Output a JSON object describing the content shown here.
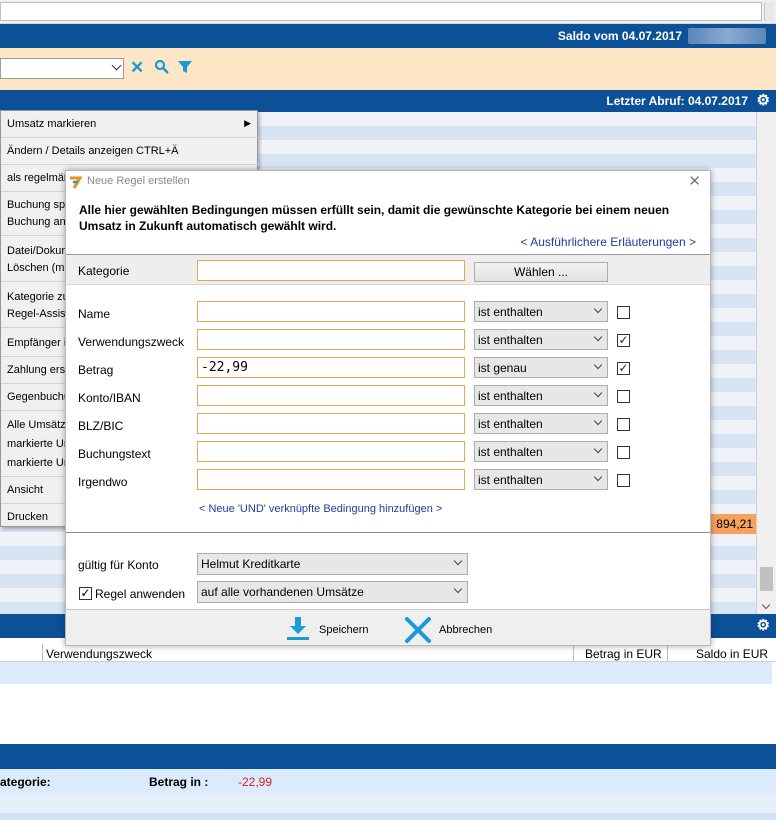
{
  "background": {
    "saldo_label": "Saldo vom 04.07.2017",
    "abruf_label": "Letzter Abruf: 04.07.2017",
    "amount_highlight": "894,21",
    "context_menu": [
      {
        "label": "Umsatz markieren",
        "submenu": true
      },
      {
        "label": "Ändern / Details anzeigen  CTRL+Ä"
      },
      {
        "label": "als regelmäß"
      },
      {
        "label": "Buchung spl",
        "label2": "Buchung an"
      },
      {
        "label": "Datei/Dokur",
        "label2": "Löschen (ma"
      },
      {
        "label": "Kategorie zu",
        "label2": "Regel-Assist"
      },
      {
        "label": "Empfänger i"
      },
      {
        "label": "Zahlung erst"
      },
      {
        "label": "Gegenbuchu"
      },
      {
        "label": "Alle Umsätze",
        "label2": "markierte Un",
        "label3": "markierte Un"
      },
      {
        "label": "Ansicht"
      },
      {
        "label": "Drucken"
      }
    ],
    "table_headers": {
      "verwendungszweck": "Verwendungszweck",
      "betrag": "Betrag in EUR",
      "saldo": "Saldo in EUR"
    },
    "info_row": {
      "kategorie_label": "ategorie:",
      "betrag_label": "Betrag in :",
      "betrag_value": "-22,99"
    },
    "colors": {
      "brand_blue": "#0c5097",
      "filter_bar": "#fde6c5",
      "negative": "#d42020",
      "highlight": "#f6a15c"
    }
  },
  "dialog": {
    "title": "Neue Regel erstellen",
    "intro_text": "Alle hier gewählten Bedingungen müssen erfüllt sein, damit die gewünschte Kategorie bei einem neuen Umsatz in Zukunft automatisch gewählt wird.",
    "more_link": "< Ausführlichere Erläuterungen >",
    "kategorie": {
      "label": "Kategorie",
      "value": "",
      "choose_button": "Wählen ..."
    },
    "conditions": [
      {
        "label": "Name",
        "value": "",
        "operator": "ist enthalten",
        "checked": false
      },
      {
        "label": "Verwendungszweck",
        "value": "",
        "operator": "ist enthalten",
        "checked": true
      },
      {
        "label": "Betrag",
        "value": "-22,99",
        "operator": "ist genau",
        "checked": true
      },
      {
        "label": "Konto/IBAN",
        "value": "",
        "operator": "ist enthalten",
        "checked": false
      },
      {
        "label": "BLZ/BIC",
        "value": "",
        "operator": "ist enthalten",
        "checked": false
      },
      {
        "label": "Buchungstext",
        "value": "",
        "operator": "ist enthalten",
        "checked": false
      },
      {
        "label": "Irgendwo",
        "value": "",
        "operator": "ist enthalten",
        "checked": false
      }
    ],
    "add_condition_link": "< Neue 'UND' verknüpfte Bedingung hinzufügen >",
    "account": {
      "label": "gültig für Konto",
      "value": "Helmut Kreditkarte"
    },
    "apply": {
      "label": "Regel anwenden",
      "checked": true,
      "value": "auf alle vorhandenen Umsätze"
    },
    "save_button": "Speichern",
    "cancel_button": "Abbrechen",
    "icon_colors": {
      "action": "#1a9ad9"
    }
  }
}
